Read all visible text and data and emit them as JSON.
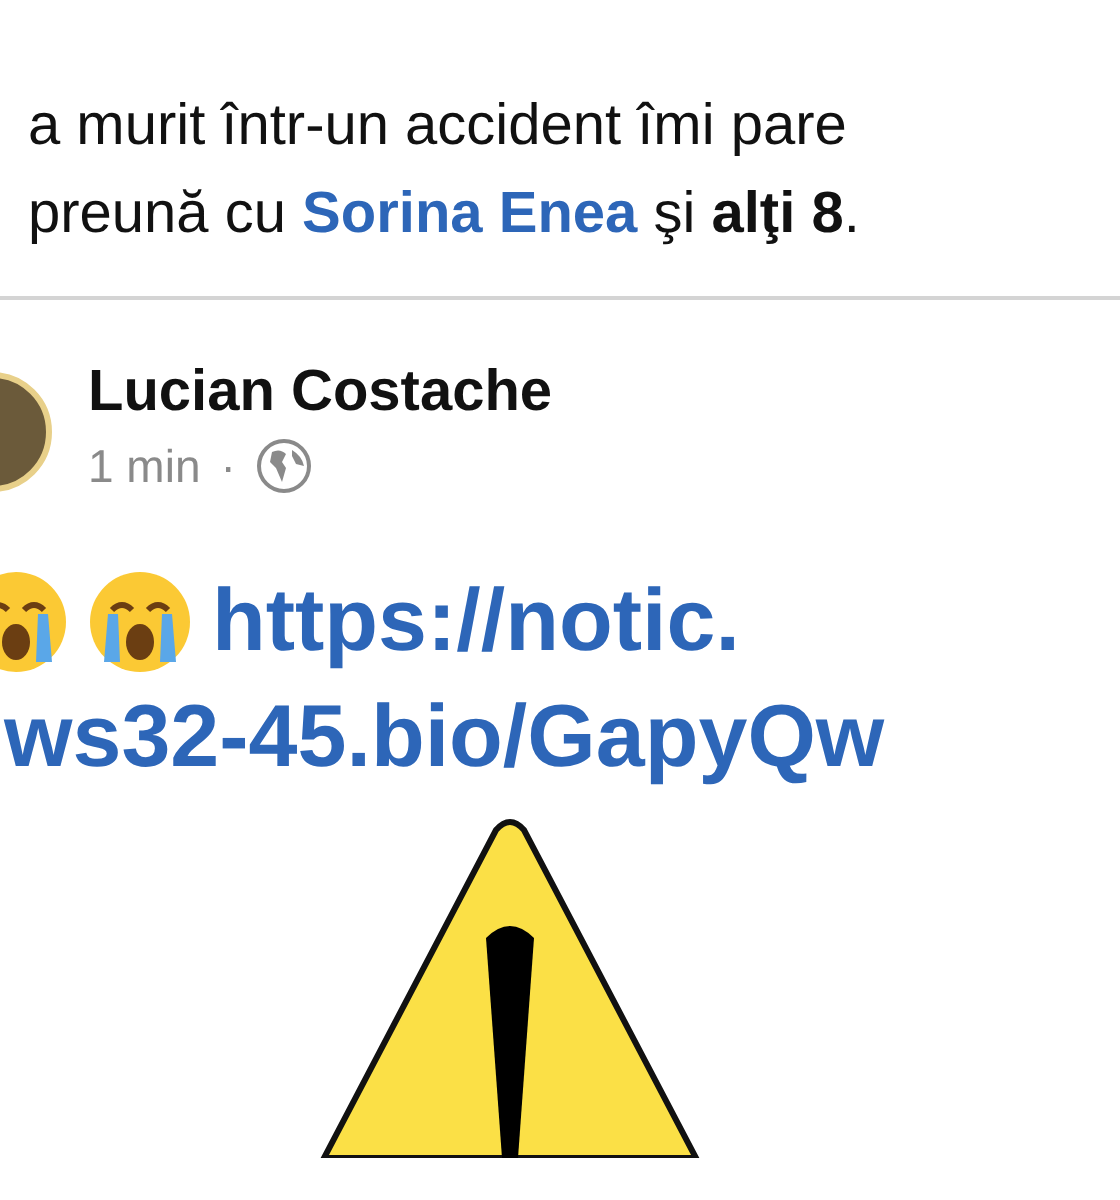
{
  "caption": {
    "line_1": "a murit într-un accident îmi pare",
    "line_2": {
      "before": "preună cu ",
      "link": "Sorina Enea",
      "after": " şi **alţi 8**."
    }
  },
  "post": {
    "author": "Lucian Costache",
    "time": "1 min",
    "separator": "·",
    "link_lines": [
      "https://notic.",
      "ws32-45.bio/GapyQw"
    ]
  }
}
